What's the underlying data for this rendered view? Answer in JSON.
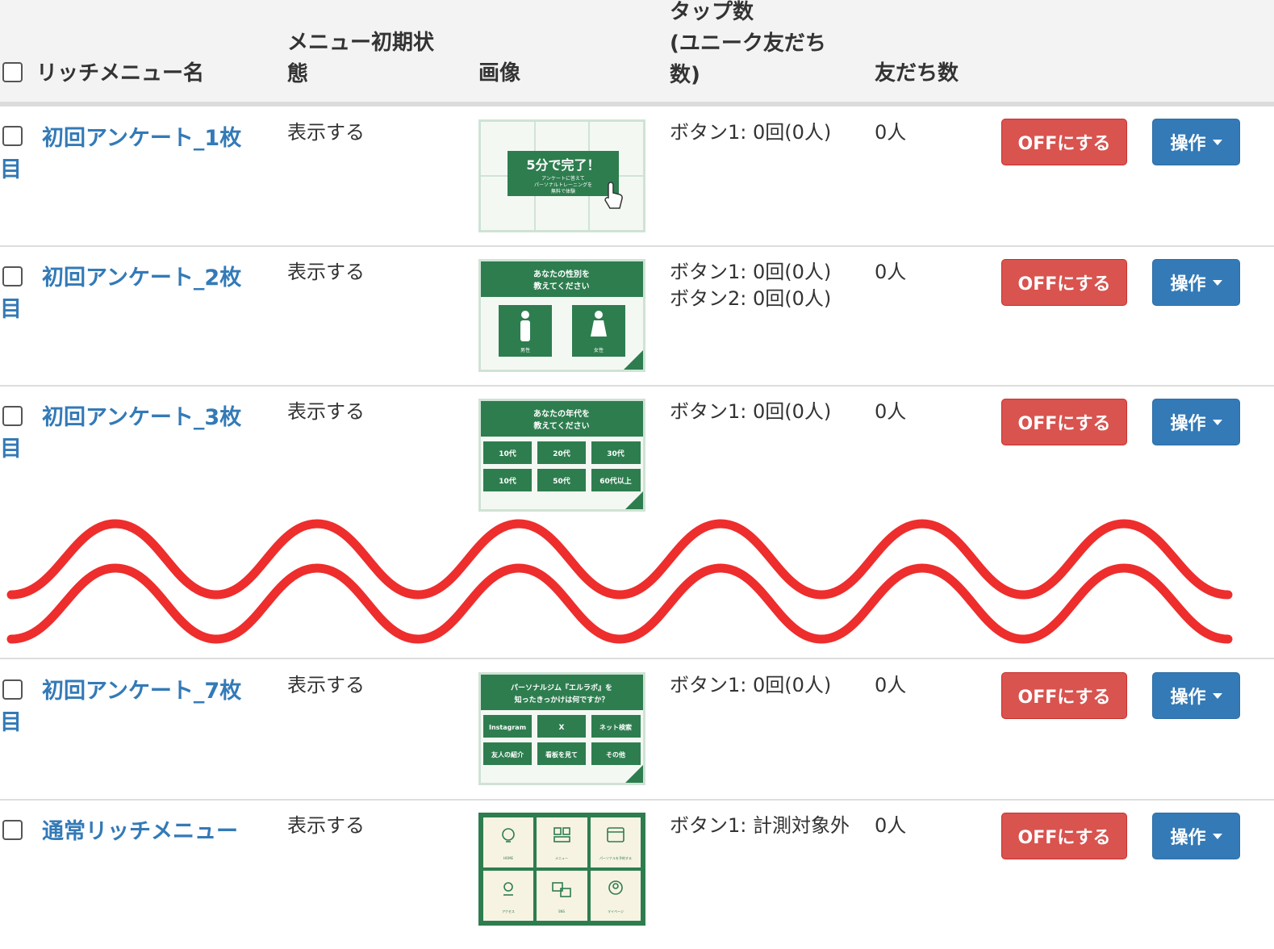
{
  "header": {
    "select_all_label": "",
    "col_name": "リッチメニュー名",
    "col_state_line1": "メニュー初期状",
    "col_state_line2": "態",
    "col_image": "画像",
    "col_tap_line1": "タップ数",
    "col_tap_line2": "(ユニーク友だち",
    "col_tap_line3": "数)",
    "col_friends": "友だち数"
  },
  "rows": [
    {
      "name_line1": "初回アンケート_1枚",
      "name_line2": "目",
      "state": "表示する",
      "taps": [
        "ボタン1: 0回(0人)"
      ],
      "friends": "0人",
      "off_label": "OFFにする",
      "op_label": "操作",
      "thumb": {
        "title": "5分で完了！",
        "sub1": "アンケートに答えて",
        "sub2": "パーソナルトレーニングを",
        "sub3": "無料で体験"
      }
    },
    {
      "name_line1": "初回アンケート_2枚",
      "name_line2": "目",
      "state": "表示する",
      "taps": [
        "ボタン1: 0回(0人)",
        "ボタン2: 0回(0人)"
      ],
      "friends": "0人",
      "off_label": "OFFにする",
      "op_label": "操作",
      "thumb": {
        "title1": "あなたの性別を",
        "title2": "教えてください",
        "opt1": "男性",
        "opt2": "女性"
      }
    },
    {
      "name_line1": "初回アンケート_3枚",
      "name_line2": "目",
      "state": "表示する",
      "taps": [
        "ボタン1: 0回(0人)"
      ],
      "friends": "0人",
      "off_label": "OFFにする",
      "op_label": "操作",
      "thumb": {
        "title1": "あなたの年代を",
        "title2": "教えてください",
        "opts": [
          "10代",
          "20代",
          "30代",
          "10代",
          "50代",
          "60代以上"
        ]
      }
    },
    {
      "name_line1": "初回アンケート_7枚",
      "name_line2": "目",
      "state": "表示する",
      "taps": [
        "ボタン1: 0回(0人)"
      ],
      "friends": "0人",
      "off_label": "OFFにする",
      "op_label": "操作",
      "thumb": {
        "title1": "パーソナルジム『エルラボ』を",
        "title2": "知ったきっかけは何ですか？",
        "opts": [
          "Instagram",
          "X",
          "ネット検索",
          "友人の紹介",
          "看板を見て",
          "その他"
        ]
      }
    },
    {
      "name_line1": "通常リッチメニュー",
      "name_line2": "",
      "state": "表示する",
      "taps": [
        "ボタン1: 計測対象外"
      ],
      "friends": "0人",
      "off_label": "OFFにする",
      "op_label": "操作",
      "thumb": {
        "labels": [
          "HOME",
          "メニュー",
          "パーソナルを予約する",
          "アクセス",
          "SNS",
          "マイページ"
        ]
      }
    }
  ],
  "colors": {
    "header_bg": "#f3f3f4",
    "link": "#337ab7",
    "danger": "#d9534f",
    "primary": "#337ab7",
    "wave": "#ee2d2d",
    "menu_green": "#2e7d4f"
  }
}
